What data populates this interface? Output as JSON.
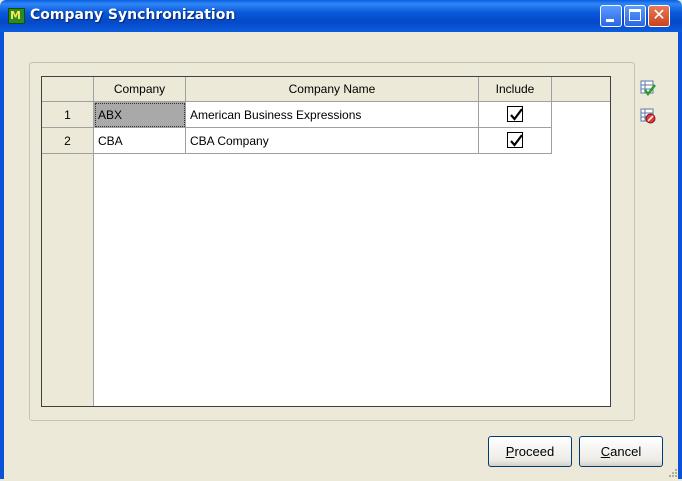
{
  "window": {
    "title": "Company Synchronization",
    "icon": "sage-mas90-app-icon",
    "icon_text": "M"
  },
  "grid": {
    "columns": [
      "Company",
      "Company Name",
      "Include"
    ],
    "rows": [
      {
        "num": "1",
        "company": "ABX",
        "name": "American Business Expressions",
        "include": true
      },
      {
        "num": "2",
        "company": "CBA",
        "name": "CBA Company",
        "include": true
      }
    ]
  },
  "side_toolbar": {
    "select_all_icon": "grid-check-icon",
    "clear_all_icon": "grid-clear-icon"
  },
  "buttons": {
    "proceed": {
      "mnemonic": "P",
      "rest": "roceed"
    },
    "cancel": {
      "mnemonic": "C",
      "rest": "ancel"
    }
  },
  "colors": {
    "titlebar": "#0a5fe0",
    "dialog_bg": "#ece9d8",
    "selected_cell": "#a9a9a9"
  }
}
